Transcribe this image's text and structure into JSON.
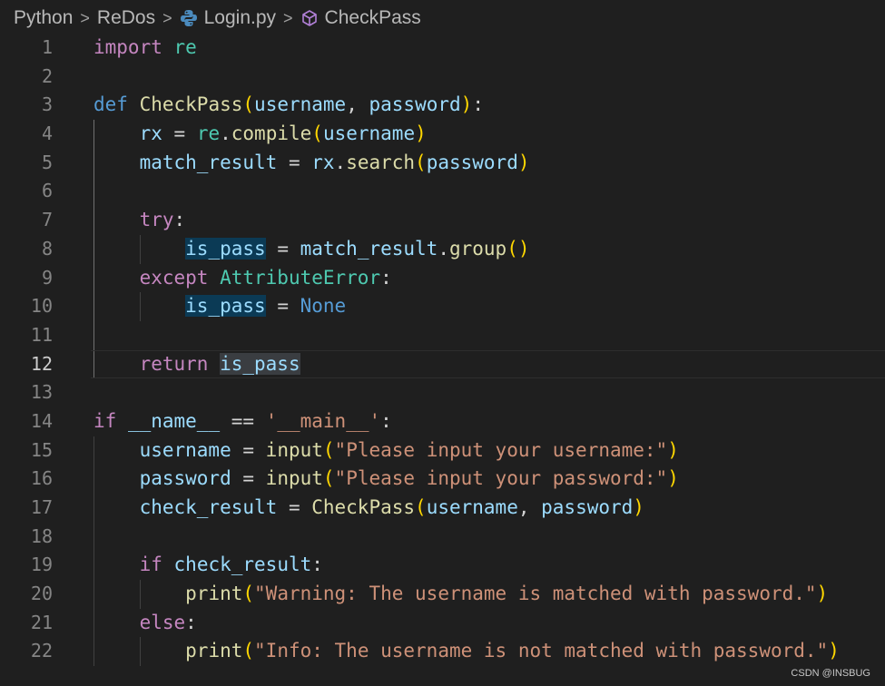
{
  "breadcrumb": {
    "items": [
      "Python",
      "ReDos",
      "Login.py",
      "CheckPass"
    ],
    "separator": ">"
  },
  "editor": {
    "current_line": 12,
    "lines": [
      {
        "num": "1",
        "tokens": [
          {
            "t": "import",
            "c": "ctl"
          },
          {
            "t": " ",
            "c": "plain"
          },
          {
            "t": "re",
            "c": "mod"
          }
        ]
      },
      {
        "num": "2",
        "tokens": []
      },
      {
        "num": "3",
        "tokens": [
          {
            "t": "def",
            "c": "kw"
          },
          {
            "t": " ",
            "c": "plain"
          },
          {
            "t": "CheckPass",
            "c": "fn"
          },
          {
            "t": "(",
            "c": "p1"
          },
          {
            "t": "username",
            "c": "var"
          },
          {
            "t": ", ",
            "c": "plain"
          },
          {
            "t": "password",
            "c": "var"
          },
          {
            "t": ")",
            "c": "p1"
          },
          {
            "t": ":",
            "c": "plain"
          }
        ]
      },
      {
        "num": "4",
        "tokens": [
          {
            "t": "    ",
            "c": "plain"
          },
          {
            "t": "rx",
            "c": "var"
          },
          {
            "t": " = ",
            "c": "plain"
          },
          {
            "t": "re",
            "c": "mod"
          },
          {
            "t": ".",
            "c": "plain"
          },
          {
            "t": "compile",
            "c": "fn"
          },
          {
            "t": "(",
            "c": "p1"
          },
          {
            "t": "username",
            "c": "var"
          },
          {
            "t": ")",
            "c": "p1"
          }
        ]
      },
      {
        "num": "5",
        "tokens": [
          {
            "t": "    ",
            "c": "plain"
          },
          {
            "t": "match_result",
            "c": "var"
          },
          {
            "t": " = ",
            "c": "plain"
          },
          {
            "t": "rx",
            "c": "var"
          },
          {
            "t": ".",
            "c": "plain"
          },
          {
            "t": "search",
            "c": "fn"
          },
          {
            "t": "(",
            "c": "p1"
          },
          {
            "t": "password",
            "c": "var"
          },
          {
            "t": ")",
            "c": "p1"
          }
        ]
      },
      {
        "num": "6",
        "tokens": []
      },
      {
        "num": "7",
        "tokens": [
          {
            "t": "    ",
            "c": "plain"
          },
          {
            "t": "try",
            "c": "ctl"
          },
          {
            "t": ":",
            "c": "plain"
          }
        ]
      },
      {
        "num": "8",
        "tokens": [
          {
            "t": "        ",
            "c": "plain"
          },
          {
            "t": "is_pass",
            "c": "var hl"
          },
          {
            "t": " = ",
            "c": "plain"
          },
          {
            "t": "match_result",
            "c": "var"
          },
          {
            "t": ".",
            "c": "plain"
          },
          {
            "t": "group",
            "c": "fn"
          },
          {
            "t": "()",
            "c": "p1"
          }
        ]
      },
      {
        "num": "9",
        "tokens": [
          {
            "t": "    ",
            "c": "plain"
          },
          {
            "t": "except",
            "c": "ctl"
          },
          {
            "t": " ",
            "c": "plain"
          },
          {
            "t": "AttributeError",
            "c": "cls"
          },
          {
            "t": ":",
            "c": "plain"
          }
        ]
      },
      {
        "num": "10",
        "tokens": [
          {
            "t": "        ",
            "c": "plain"
          },
          {
            "t": "is_pass",
            "c": "var hl"
          },
          {
            "t": " = ",
            "c": "plain"
          },
          {
            "t": "None",
            "c": "kw"
          }
        ]
      },
      {
        "num": "11",
        "tokens": []
      },
      {
        "num": "12",
        "tokens": [
          {
            "t": "    ",
            "c": "plain"
          },
          {
            "t": "return",
            "c": "ctl"
          },
          {
            "t": " ",
            "c": "plain"
          },
          {
            "t": "is_pass",
            "c": "var hl-cur"
          }
        ]
      },
      {
        "num": "13",
        "tokens": []
      },
      {
        "num": "14",
        "tokens": [
          {
            "t": "if",
            "c": "ctl"
          },
          {
            "t": " ",
            "c": "plain"
          },
          {
            "t": "__name__",
            "c": "var"
          },
          {
            "t": " == ",
            "c": "plain"
          },
          {
            "t": "'__main__'",
            "c": "str"
          },
          {
            "t": ":",
            "c": "plain"
          }
        ]
      },
      {
        "num": "15",
        "tokens": [
          {
            "t": "    ",
            "c": "plain"
          },
          {
            "t": "username",
            "c": "var"
          },
          {
            "t": " = ",
            "c": "plain"
          },
          {
            "t": "input",
            "c": "fn"
          },
          {
            "t": "(",
            "c": "p1"
          },
          {
            "t": "\"Please input your username:\"",
            "c": "str"
          },
          {
            "t": ")",
            "c": "p1"
          }
        ]
      },
      {
        "num": "16",
        "tokens": [
          {
            "t": "    ",
            "c": "plain"
          },
          {
            "t": "password",
            "c": "var"
          },
          {
            "t": " = ",
            "c": "plain"
          },
          {
            "t": "input",
            "c": "fn"
          },
          {
            "t": "(",
            "c": "p1"
          },
          {
            "t": "\"Please input your password:\"",
            "c": "str"
          },
          {
            "t": ")",
            "c": "p1"
          }
        ]
      },
      {
        "num": "17",
        "tokens": [
          {
            "t": "    ",
            "c": "plain"
          },
          {
            "t": "check_result",
            "c": "var"
          },
          {
            "t": " = ",
            "c": "plain"
          },
          {
            "t": "CheckPass",
            "c": "fn"
          },
          {
            "t": "(",
            "c": "p1"
          },
          {
            "t": "username",
            "c": "var"
          },
          {
            "t": ", ",
            "c": "plain"
          },
          {
            "t": "password",
            "c": "var"
          },
          {
            "t": ")",
            "c": "p1"
          }
        ]
      },
      {
        "num": "18",
        "tokens": []
      },
      {
        "num": "19",
        "tokens": [
          {
            "t": "    ",
            "c": "plain"
          },
          {
            "t": "if",
            "c": "ctl"
          },
          {
            "t": " ",
            "c": "plain"
          },
          {
            "t": "check_result",
            "c": "var"
          },
          {
            "t": ":",
            "c": "plain"
          }
        ]
      },
      {
        "num": "20",
        "tokens": [
          {
            "t": "        ",
            "c": "plain"
          },
          {
            "t": "print",
            "c": "fn"
          },
          {
            "t": "(",
            "c": "p1"
          },
          {
            "t": "\"Warning: The username is matched with password.\"",
            "c": "str"
          },
          {
            "t": ")",
            "c": "p1"
          }
        ]
      },
      {
        "num": "21",
        "tokens": [
          {
            "t": "    ",
            "c": "plain"
          },
          {
            "t": "else",
            "c": "ctl"
          },
          {
            "t": ":",
            "c": "plain"
          }
        ]
      },
      {
        "num": "22",
        "tokens": [
          {
            "t": "        ",
            "c": "plain"
          },
          {
            "t": "print",
            "c": "fn"
          },
          {
            "t": "(",
            "c": "p1"
          },
          {
            "t": "\"Info: The username is not matched with password.\"",
            "c": "str"
          },
          {
            "t": ")",
            "c": "p1"
          }
        ]
      }
    ]
  },
  "watermark": "CSDN @INSBUG"
}
